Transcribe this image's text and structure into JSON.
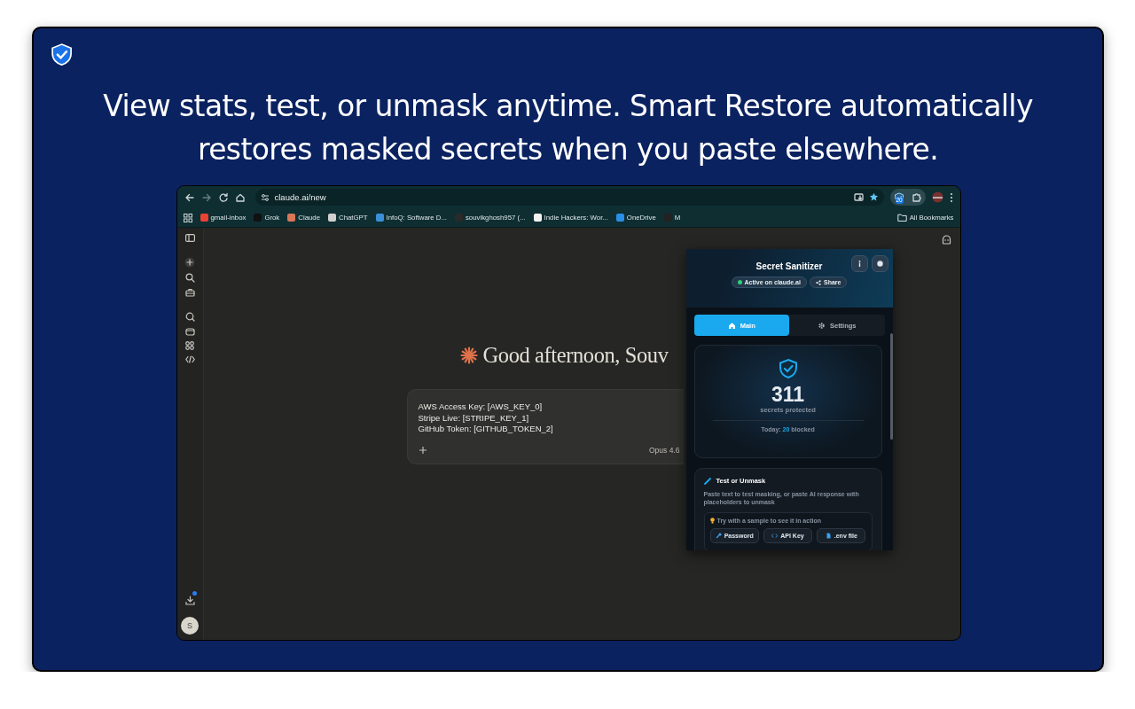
{
  "headline": "View stats, test, or unmask anytime. Smart Restore automatically restores masked secrets when you paste elsewhere.",
  "browser": {
    "url": "claude.ai/new",
    "extension_badge": "20",
    "bookmarks": [
      {
        "label": "gmail-inbox",
        "color": "#ea4335"
      },
      {
        "label": "Grok",
        "color": "#111111"
      },
      {
        "label": "Claude",
        "color": "#d97757"
      },
      {
        "label": "ChatGPT",
        "color": "#d0d0d0"
      },
      {
        "label": "InfoQ: Software D...",
        "color": "#3a8fd8"
      },
      {
        "label": "souvikghosh957 (...",
        "color": "#2a2a2a"
      },
      {
        "label": "Indie Hackers: Wor...",
        "color": "#f2f2f2"
      },
      {
        "label": "OneDrive",
        "color": "#2b8ee6"
      },
      {
        "label": "M",
        "color": "#222222"
      }
    ],
    "all_bookmarks": "All Bookmarks"
  },
  "chat": {
    "greeting": "Good afternoon, Souv",
    "prompt_lines": [
      "AWS Access Key: [AWS_KEY_0]",
      "Stripe Live: [STRIPE_KEY_1]",
      "GitHub Token: [GITHUB_TOKEN_2]"
    ],
    "model": "Opus 4.6",
    "avatar": "S"
  },
  "popup": {
    "title": "Secret Sanitizer",
    "status": "Active on claude.ai",
    "share": "Share",
    "tabs": [
      {
        "label": "Main",
        "selected": true
      },
      {
        "label": "Settings",
        "selected": false
      }
    ],
    "count": "311",
    "count_label": "secrets protected",
    "today": "Today: **20** blocked",
    "test_title": "Test or Unmask",
    "test_desc": "Paste text to test masking, or paste AI response with placeholders to unmask",
    "sample_hint": "Try with a sample to see it in action",
    "samples": [
      {
        "label": "Password",
        "kind": "key"
      },
      {
        "label": "API Key",
        "kind": "code"
      },
      {
        "label": ".env file",
        "kind": "file"
      }
    ]
  }
}
